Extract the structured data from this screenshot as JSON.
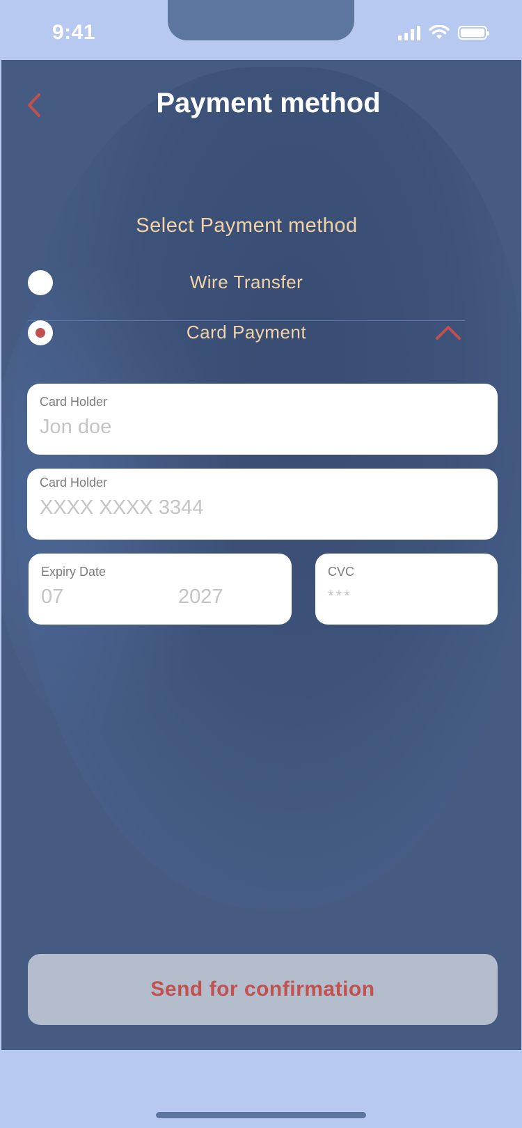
{
  "status_bar": {
    "time": "9:41"
  },
  "header": {
    "title": "Payment method"
  },
  "section": {
    "title": "Select Payment method"
  },
  "options": [
    {
      "label": "Wire Transfer",
      "selected": false
    },
    {
      "label": "Card Payment",
      "selected": true,
      "expanded": true
    }
  ],
  "form": {
    "card_holder": {
      "label": "Card Holder",
      "value": "Jon doe"
    },
    "card_number": {
      "label": "Card Holder",
      "value": "XXXX XXXX 3344"
    },
    "expiry": {
      "label": "Expiry Date",
      "month": "07",
      "year": "2027"
    },
    "cvc": {
      "label": "CVC",
      "value": "***"
    }
  },
  "actions": {
    "send_label": "Send for confirmation"
  },
  "colors": {
    "accent": "#c1504f",
    "label_text": "#f2d3a7",
    "background": "#465b82",
    "frame": "#b7c9f1"
  },
  "icons": [
    "back-chevron-icon",
    "cellular-signal-icon",
    "wifi-icon",
    "battery-icon",
    "chevron-up-icon"
  ]
}
